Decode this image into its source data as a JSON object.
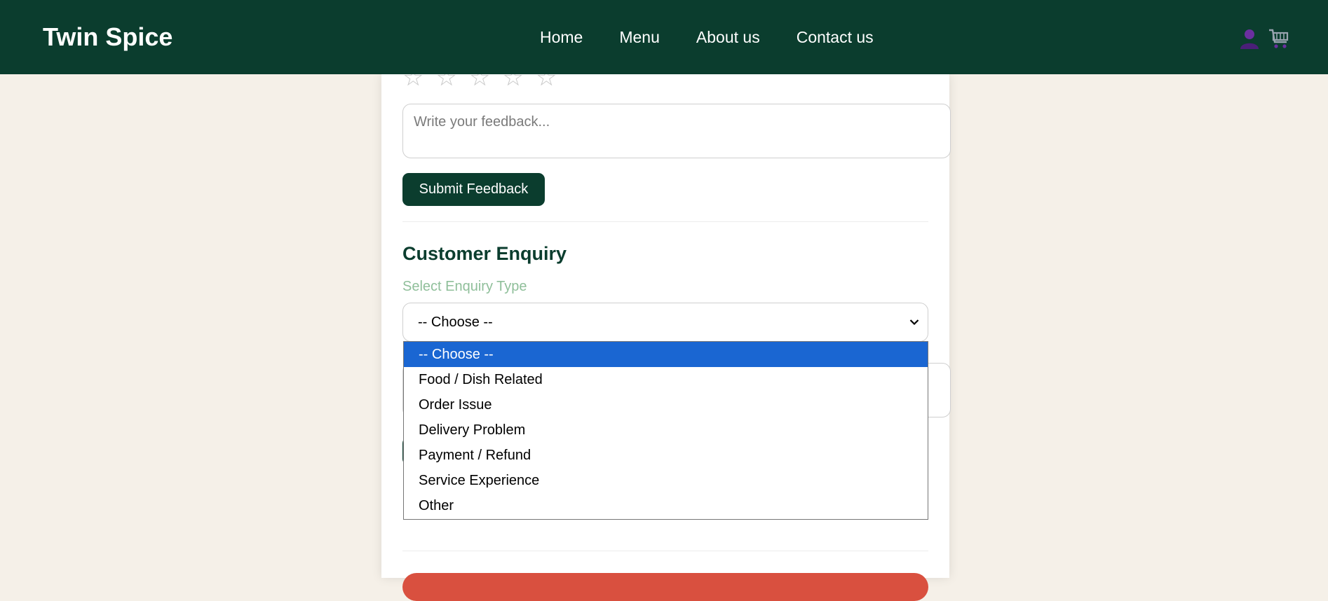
{
  "header": {
    "brand": "Twin Spice",
    "nav": [
      "Home",
      "Menu",
      "About us",
      "Contact us"
    ],
    "icons": [
      "user-icon",
      "cart-icon"
    ]
  },
  "feedback": {
    "rating_max": 5,
    "rating": 0,
    "star_glyph": "☆",
    "placeholder": "Write your feedback...",
    "submit_label": "Submit Feedback"
  },
  "enquiry": {
    "title": "Customer Enquiry",
    "select_label": "Select Enquiry Type",
    "selected": "-- Choose --",
    "options": [
      "-- Choose --",
      "Food / Dish Related",
      "Order Issue",
      "Delivery Problem",
      "Payment / Refund",
      "Service Experience",
      "Other"
    ]
  },
  "colors": {
    "header_bg": "#0b3d2e",
    "page_bg": "#f5f0e8",
    "accent_green": "#0b3d2e",
    "label_green": "#8fbf9a",
    "danger": "#d9503f",
    "option_highlight": "#1a66d2"
  }
}
